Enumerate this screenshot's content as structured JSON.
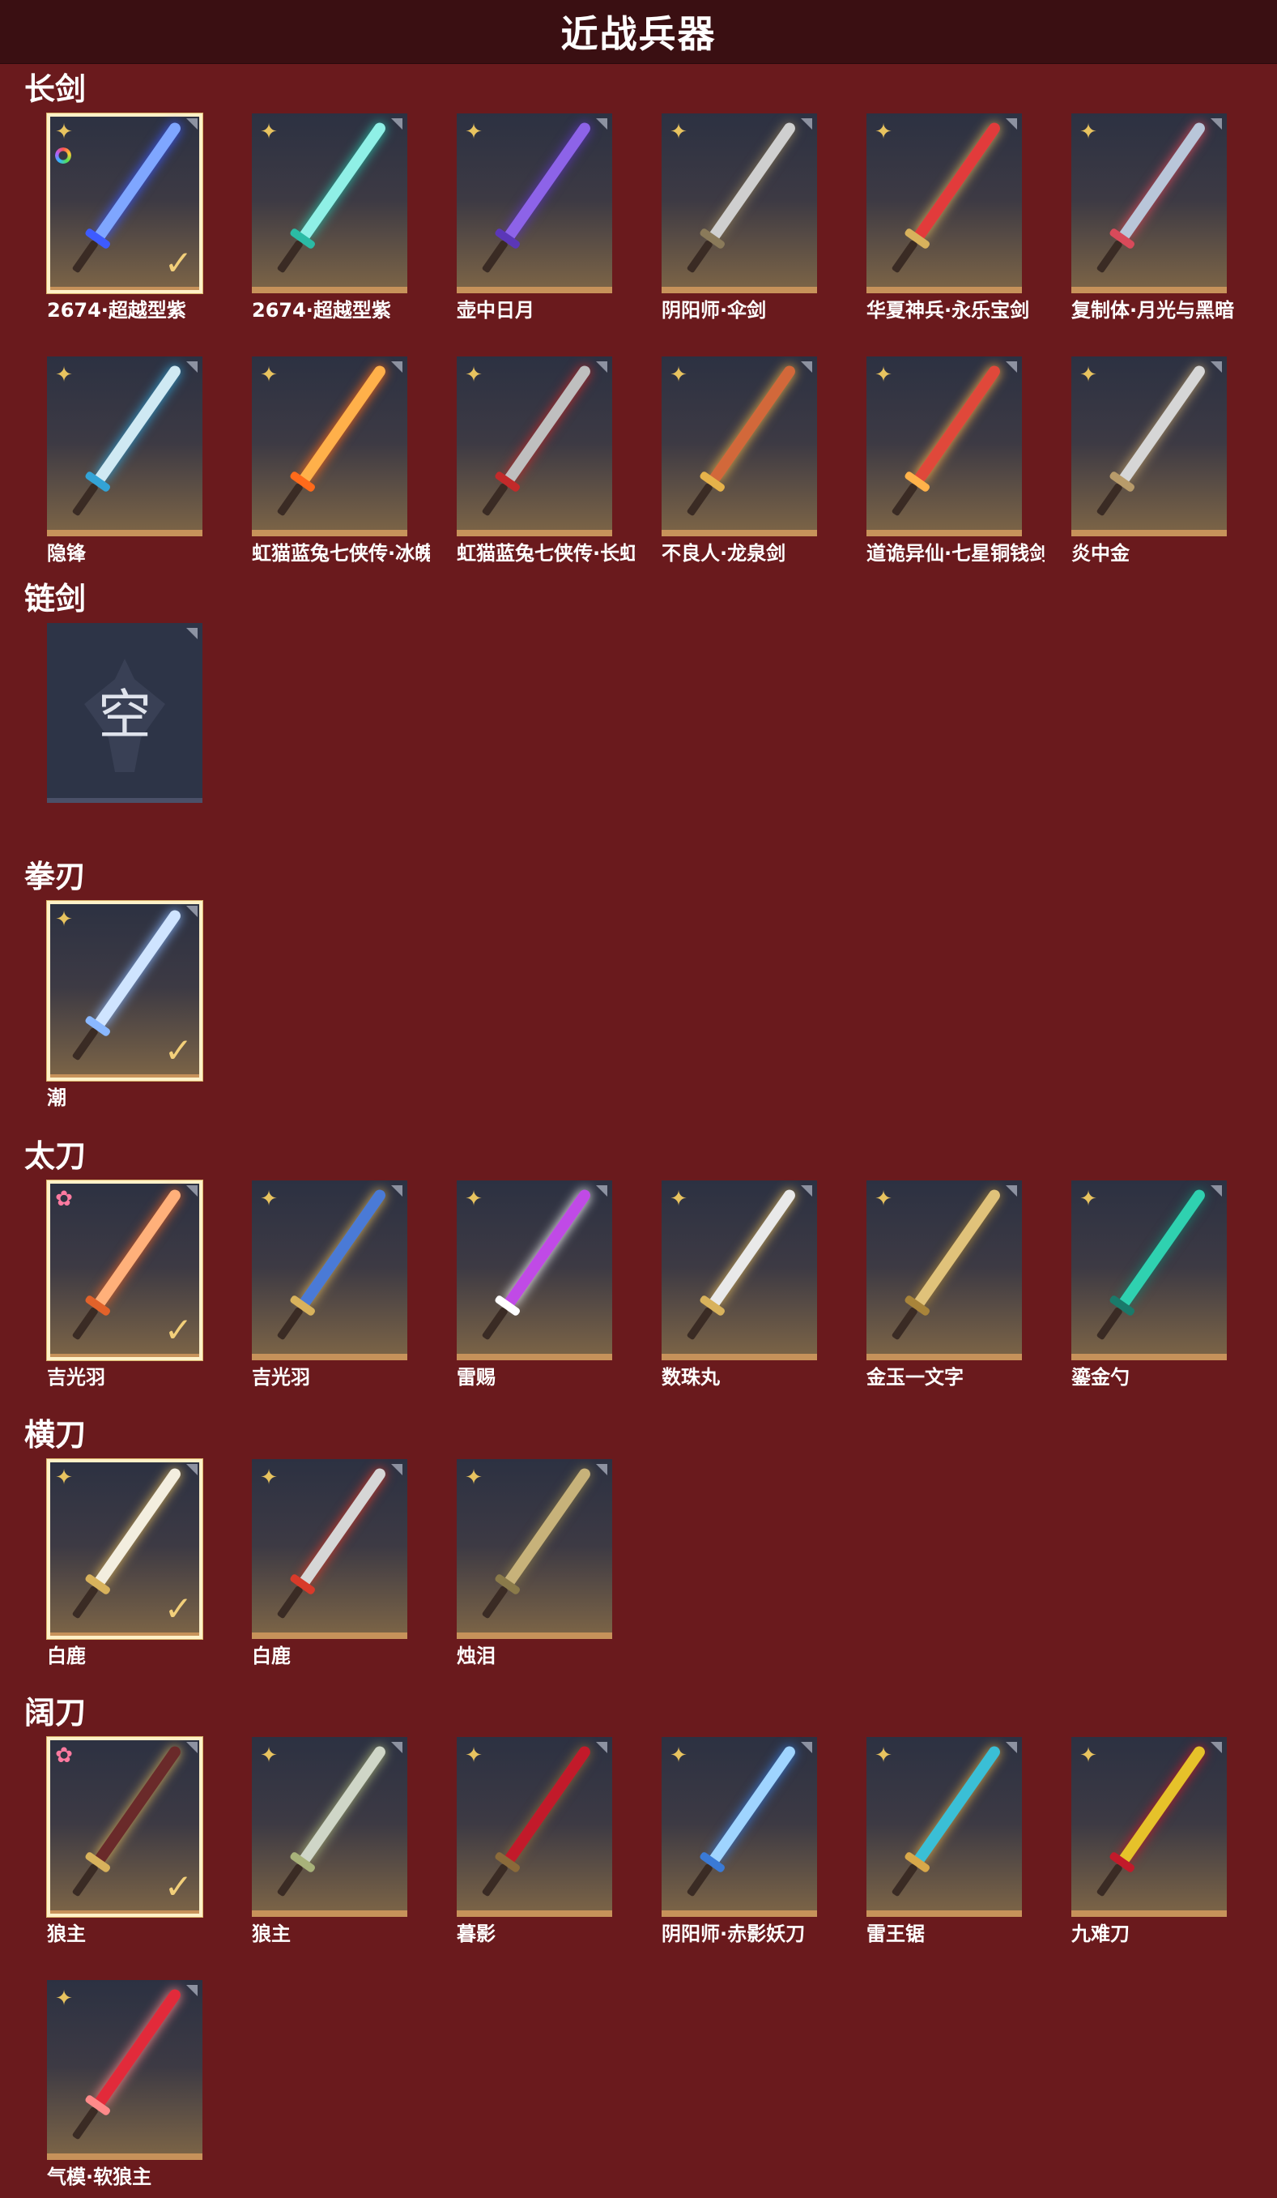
{
  "page_title": "近战兵器",
  "colors": {
    "background": "#6a1a1d",
    "header": "#3a0f12",
    "accent": "#c7925a",
    "badge_gold": "#e8c35f",
    "badge_pink": "#ff7aa0"
  },
  "sections": [
    {
      "title": "长剑",
      "items": [
        {
          "name": "2674·超越型紫",
          "badge": "gold",
          "selected": true,
          "rainbow": true,
          "colors": [
            "#7fa6ff",
            "#3d5bff"
          ]
        },
        {
          "name": "2674·超越型紫",
          "badge": "gold",
          "colors": [
            "#8ff0e6",
            "#2bbba5"
          ]
        },
        {
          "name": "壶中日月",
          "badge": "gold",
          "colors": [
            "#8d63e8",
            "#5b37b8"
          ]
        },
        {
          "name": "阴阳师·伞剑",
          "badge": "gold",
          "colors": [
            "#cfcfcf",
            "#8a7a5a"
          ]
        },
        {
          "name": "华夏神兵·永乐宝剑",
          "badge": "gold",
          "colors": [
            "#e23b3b",
            "#d8b25c"
          ]
        },
        {
          "name": "复制体·月光与黑暗",
          "badge": "gold",
          "colors": [
            "#b9c6d9",
            "#d84a5a"
          ]
        },
        {
          "name": "隐锋",
          "badge": "gold",
          "colors": [
            "#cfe9f3",
            "#33a3d6"
          ]
        },
        {
          "name": "虹猫蓝兔七侠传·冰魄...",
          "badge": "gold",
          "colors": [
            "#ffb04a",
            "#ff6a1a"
          ]
        },
        {
          "name": "虹猫蓝兔七侠传·长虹...",
          "badge": "gold",
          "colors": [
            "#bfbfbf",
            "#c22a2a"
          ]
        },
        {
          "name": "不良人·龙泉剑",
          "badge": "gold",
          "colors": [
            "#d2683a",
            "#e6b24a"
          ]
        },
        {
          "name": "道诡异仙·七星铜钱剑",
          "badge": "gold",
          "colors": [
            "#e0483a",
            "#ffb24a"
          ]
        },
        {
          "name": "炎中金",
          "badge": "gold",
          "colors": [
            "#d6d6d6",
            "#b89b6a"
          ]
        }
      ]
    },
    {
      "title": "链剑",
      "items": [
        {
          "name": "",
          "empty": true,
          "empty_text": "空"
        }
      ]
    },
    {
      "title": "拳刃",
      "items": [
        {
          "name": "潮",
          "badge": "gold",
          "selected": true,
          "colors": [
            "#cfe4ff",
            "#8ab8ff"
          ]
        }
      ]
    },
    {
      "title": "太刀",
      "items": [
        {
          "name": "吉光羽",
          "badge": "pink",
          "selected": true,
          "colors": [
            "#ffb07a",
            "#e2622a"
          ]
        },
        {
          "name": "吉光羽",
          "badge": "gold",
          "colors": [
            "#4a7ad6",
            "#d8b25c"
          ]
        },
        {
          "name": "雷赐",
          "badge": "gold",
          "colors": [
            "#c04ae6",
            "#ffffff"
          ]
        },
        {
          "name": "数珠丸",
          "badge": "gold",
          "colors": [
            "#e9e9e9",
            "#d8b25c"
          ]
        },
        {
          "name": "金玉一文字",
          "badge": "gold",
          "colors": [
            "#e0c27a",
            "#a8843a"
          ]
        },
        {
          "name": "鎏金勺",
          "badge": "gold",
          "colors": [
            "#2fd1b0",
            "#1a7a6a"
          ]
        }
      ]
    },
    {
      "title": "横刀",
      "items": [
        {
          "name": "白鹿",
          "badge": "gold",
          "selected": true,
          "colors": [
            "#f3eedf",
            "#d8b25c"
          ]
        },
        {
          "name": "白鹿",
          "badge": "gold",
          "colors": [
            "#d6d6d6",
            "#d83a2a"
          ]
        },
        {
          "name": "烛泪",
          "badge": "gold",
          "colors": [
            "#c7b27a",
            "#8a7a4a"
          ]
        }
      ]
    },
    {
      "title": "阔刀",
      "items": [
        {
          "name": "狼主",
          "badge": "pink",
          "selected": true,
          "colors": [
            "#6a2a2a",
            "#d8b25c"
          ]
        },
        {
          "name": "狼主",
          "badge": "gold",
          "colors": [
            "#cfd6c7",
            "#a8b27a"
          ]
        },
        {
          "name": "暮影",
          "badge": "gold",
          "colors": [
            "#c21a2a",
            "#8a6a3a"
          ]
        },
        {
          "name": "阴阳师·赤影妖刀",
          "badge": "gold",
          "colors": [
            "#9fd4ff",
            "#3a7ad6"
          ]
        },
        {
          "name": "雷王锯",
          "badge": "gold",
          "colors": [
            "#3abfd6",
            "#d8a84a"
          ]
        },
        {
          "name": "九难刀",
          "badge": "gold",
          "colors": [
            "#e6c22a",
            "#c21a2a"
          ]
        },
        {
          "name": "气模·软狼主",
          "badge": "gold",
          "colors": [
            "#e22a3a",
            "#ff8a8a"
          ]
        }
      ]
    }
  ]
}
